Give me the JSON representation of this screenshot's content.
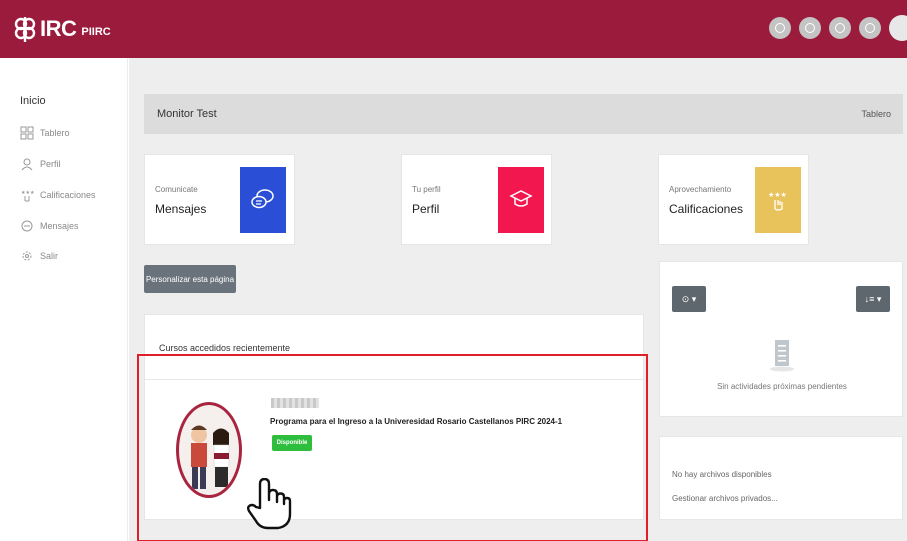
{
  "brand": {
    "logo_text": "IRC",
    "logo_sub": "PIIRC",
    "bar_color": "#9a1b3c"
  },
  "top_icons": [
    "notification-icon",
    "bell-icon",
    "chat-icon",
    "settings-icon",
    "user-avatar"
  ],
  "sidebar": {
    "home_label": "Inicio",
    "items": [
      {
        "label": "Tablero",
        "icon": "dashboard-icon"
      },
      {
        "label": "Perfil",
        "icon": "profile-icon"
      },
      {
        "label": "Calificaciones",
        "icon": "grades-icon"
      },
      {
        "label": "Mensajes",
        "icon": "messages-icon"
      },
      {
        "label": "Salir",
        "icon": "logout-icon"
      }
    ]
  },
  "header": {
    "title": "Monitor Test",
    "link": "Tablero"
  },
  "cards": [
    {
      "small": "Comunicate",
      "big": "Mensajes",
      "color": "#2a4fd6",
      "icon": "chat-bubbles-icon"
    },
    {
      "small": "Tu perfil",
      "big": "Perfil",
      "color": "#f2184f",
      "icon": "graduation-cap-icon"
    },
    {
      "small": "Aprovechamiento",
      "big": "Calificaciones",
      "color": "#e8c25b",
      "icon": "stars-hand-icon"
    }
  ],
  "customize_button": "Personalizar esta página",
  "courses": {
    "section_title": "Cursos accedidos recientemente",
    "items": [
      {
        "name": "Programa para el Ingreso a la Univeresidad Rosario Castellanos PIRC 2024-1",
        "status": "Disponible"
      }
    ]
  },
  "timeline": {
    "filter_button": "⊙ ▾",
    "sort_button": "↓≡ ▾",
    "empty_text": "Sin actividades próximas pendientes"
  },
  "files": {
    "empty_text": "No hay archivos disponibles",
    "manage_link": "Gestionar archivos privados..."
  },
  "highlight_color": "#e01f2a"
}
